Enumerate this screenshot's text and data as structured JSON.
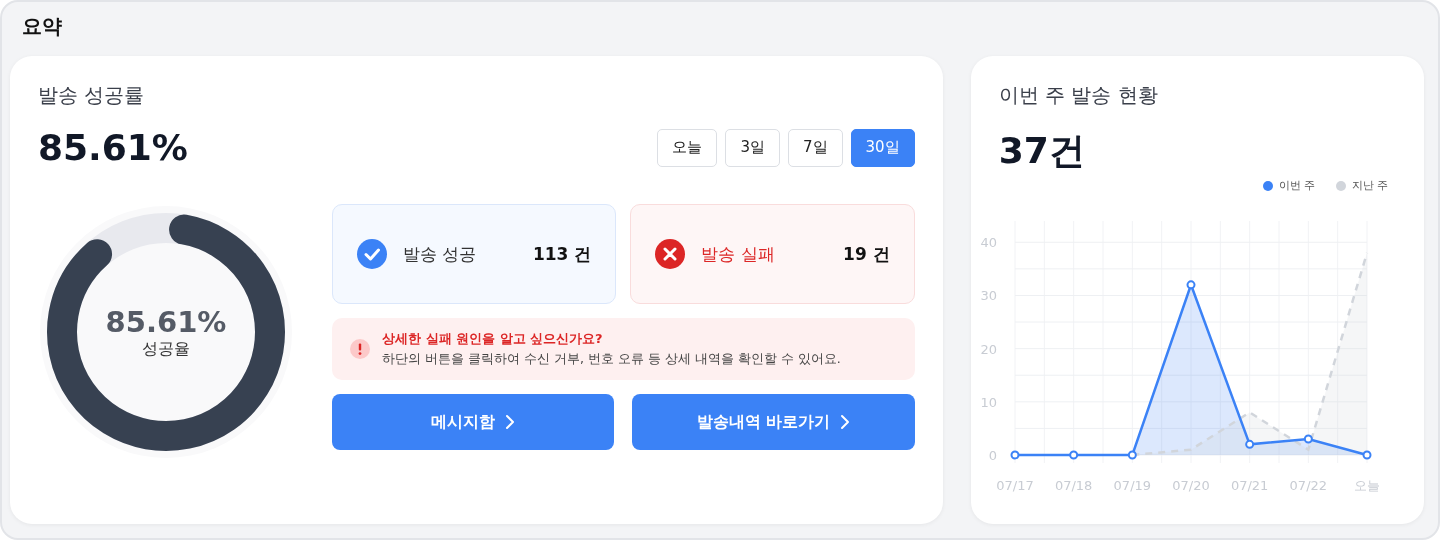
{
  "title": "요약",
  "success_card": {
    "title": "발송 성공률",
    "rate": "85.61%",
    "periods": [
      {
        "label": "오늘",
        "selected": false
      },
      {
        "label": "3일",
        "selected": false
      },
      {
        "label": "7일",
        "selected": false
      },
      {
        "label": "30일",
        "selected": true
      }
    ],
    "donut": {
      "level": 0.8561,
      "value": "85.61%",
      "caption": "성공율"
    },
    "stats": [
      {
        "kind": "success",
        "label": "발송 성공",
        "count": "113 건"
      },
      {
        "kind": "failure",
        "label": "발송 실패",
        "count": "19 건"
      }
    ],
    "notice": {
      "title": "상세한 실패 원인을 알고 싶으신가요?",
      "text": "하단의 버튼을 클릭하여 수신 거부, 번호 오류 등 상세 내역을 확인할 수 있어요."
    },
    "buttons": [
      "메시지함",
      "발송내역 바로가기"
    ]
  },
  "weekly_card": {
    "title": "이번 주 발송 현황",
    "total": "37건",
    "chart_data": {
      "type": "area",
      "grid": true,
      "categories": [
        "07/17",
        "07/18",
        "07/19",
        "07/20",
        "07/21",
        "07/22",
        "오늘"
      ],
      "ylim": [
        0,
        44
      ],
      "yticks": [
        0,
        10,
        20,
        30,
        40
      ],
      "series": [
        {
          "name": "이번 주",
          "color": "#3b82f6",
          "marker": "circle",
          "line_style": "solid",
          "values": [
            0,
            0,
            0,
            32,
            2,
            3,
            0
          ]
        },
        {
          "name": "지난 주",
          "color": "#d1d5db",
          "marker": "none",
          "line_style": "dashed",
          "values": [
            null,
            null,
            0,
            1,
            8,
            1,
            38
          ]
        }
      ]
    }
  }
}
